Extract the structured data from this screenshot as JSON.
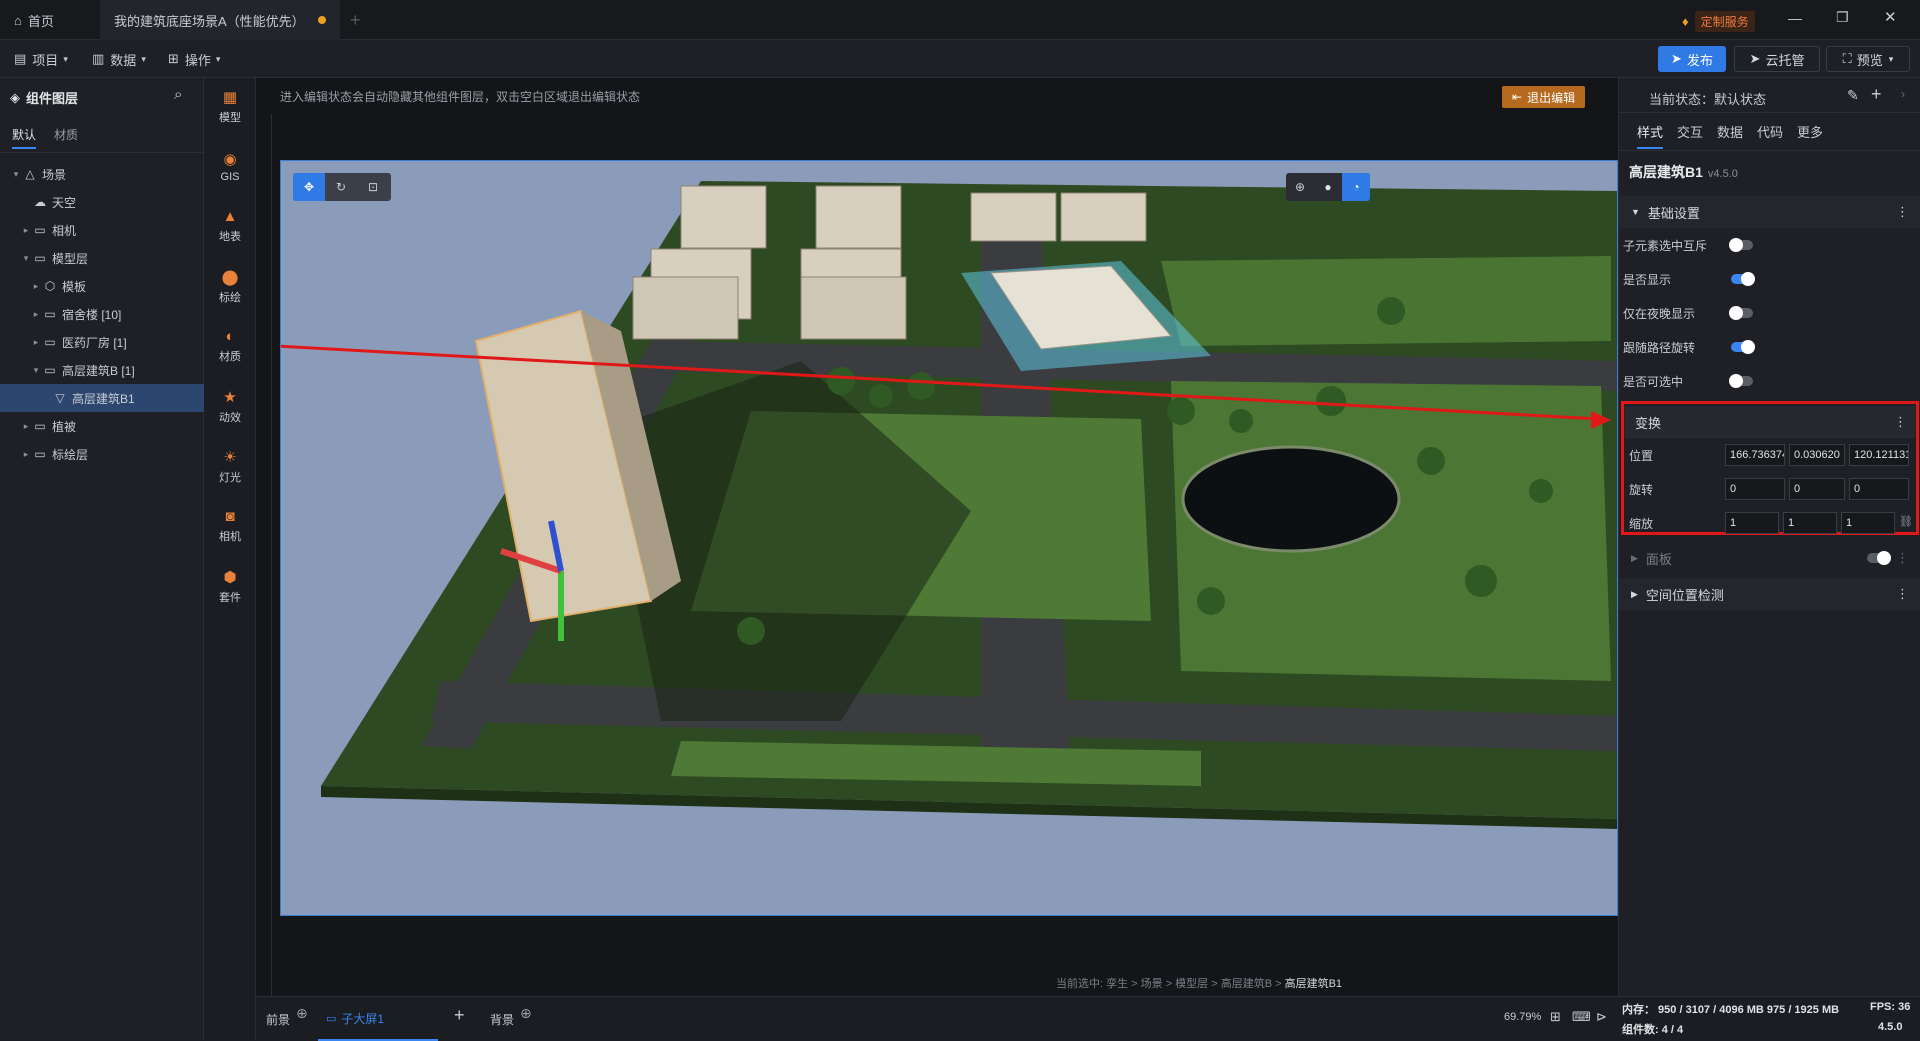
{
  "titlebar": {
    "home_tab": "首页",
    "doc_tab": "我的建筑底座场景A（性能优先）",
    "custom_service": "定制服务"
  },
  "menubar": {
    "project": "项目",
    "data": "数据",
    "operate": "操作",
    "publish": "发布",
    "cloud": "云托管",
    "preview": "预览"
  },
  "leftpanel": {
    "title": "组件图层",
    "tabs": [
      "默认",
      "材质"
    ],
    "tree": [
      {
        "label": "场景",
        "indent": 0,
        "caret": "▾",
        "icon": "△"
      },
      {
        "label": "天空",
        "indent": 1,
        "caret": "",
        "icon": "☁"
      },
      {
        "label": "相机",
        "indent": 1,
        "caret": "▸",
        "icon": "▭"
      },
      {
        "label": "模型层",
        "indent": 1,
        "caret": "▾",
        "icon": "▭"
      },
      {
        "label": "模板",
        "indent": 2,
        "caret": "▸",
        "icon": "⬡"
      },
      {
        "label": "宿舍楼 [10]",
        "indent": 2,
        "caret": "▸",
        "icon": "▭"
      },
      {
        "label": "医药厂房 [1]",
        "indent": 2,
        "caret": "▸",
        "icon": "▭"
      },
      {
        "label": "高层建筑B [1]",
        "indent": 2,
        "caret": "▾",
        "icon": "▭"
      },
      {
        "label": "高层建筑B1",
        "indent": 3,
        "caret": "",
        "icon": "▽",
        "selected": true
      },
      {
        "label": "植被",
        "indent": 1,
        "caret": "▸",
        "icon": "▭"
      },
      {
        "label": "标绘层",
        "indent": 1,
        "caret": "▸",
        "icon": "▭"
      }
    ]
  },
  "tools": [
    "模型",
    "GIS",
    "地表",
    "标绘",
    "材质",
    "动效",
    "灯光",
    "相机",
    "套件"
  ],
  "canvas": {
    "hint": "进入编辑状态会自动隐藏其他组件图层，双击空白区域退出编辑状态",
    "exit_edit": "退出编辑",
    "breadcrumb": "当前选中: 孪生 > 场景 > 模型层 > 高层建筑B > ",
    "breadcrumb_last": "高层建筑B1"
  },
  "rightpanel": {
    "current_state": "当前状态：默认状态",
    "tabs": [
      "样式",
      "交互",
      "数据",
      "代码",
      "更多"
    ],
    "component_name": "高层建筑B1",
    "version": "v4.5.0",
    "basic_settings": "基础设置",
    "props": [
      {
        "label": "子元素选中互斥",
        "on": false
      },
      {
        "label": "是否显示",
        "on": true
      },
      {
        "label": "仅在夜晚显示",
        "on": false
      },
      {
        "label": "跟随路径旋转",
        "on": true
      },
      {
        "label": "是否可选中",
        "on": false
      }
    ],
    "transform": "变换",
    "position_label": "位置",
    "position": [
      "166.736374",
      "0.030620",
      "120.121131"
    ],
    "rotation_label": "旋转",
    "rotation": [
      "0",
      "0",
      "0"
    ],
    "scale_label": "缩放",
    "scale": [
      "1",
      "1",
      "1"
    ],
    "panel_label": "面板",
    "spatial_check": "空间位置检测"
  },
  "bottombar": {
    "foreground": "前景",
    "sub_screen": "子大屏1",
    "background": "背景",
    "zoom": "69.79%",
    "memory": "内存：  950 / 3107 / 4096 MB  975 / 1925 MB",
    "fps": "FPS:  36",
    "components": "组件数: 4 / 4",
    "version": "4.5.0"
  }
}
